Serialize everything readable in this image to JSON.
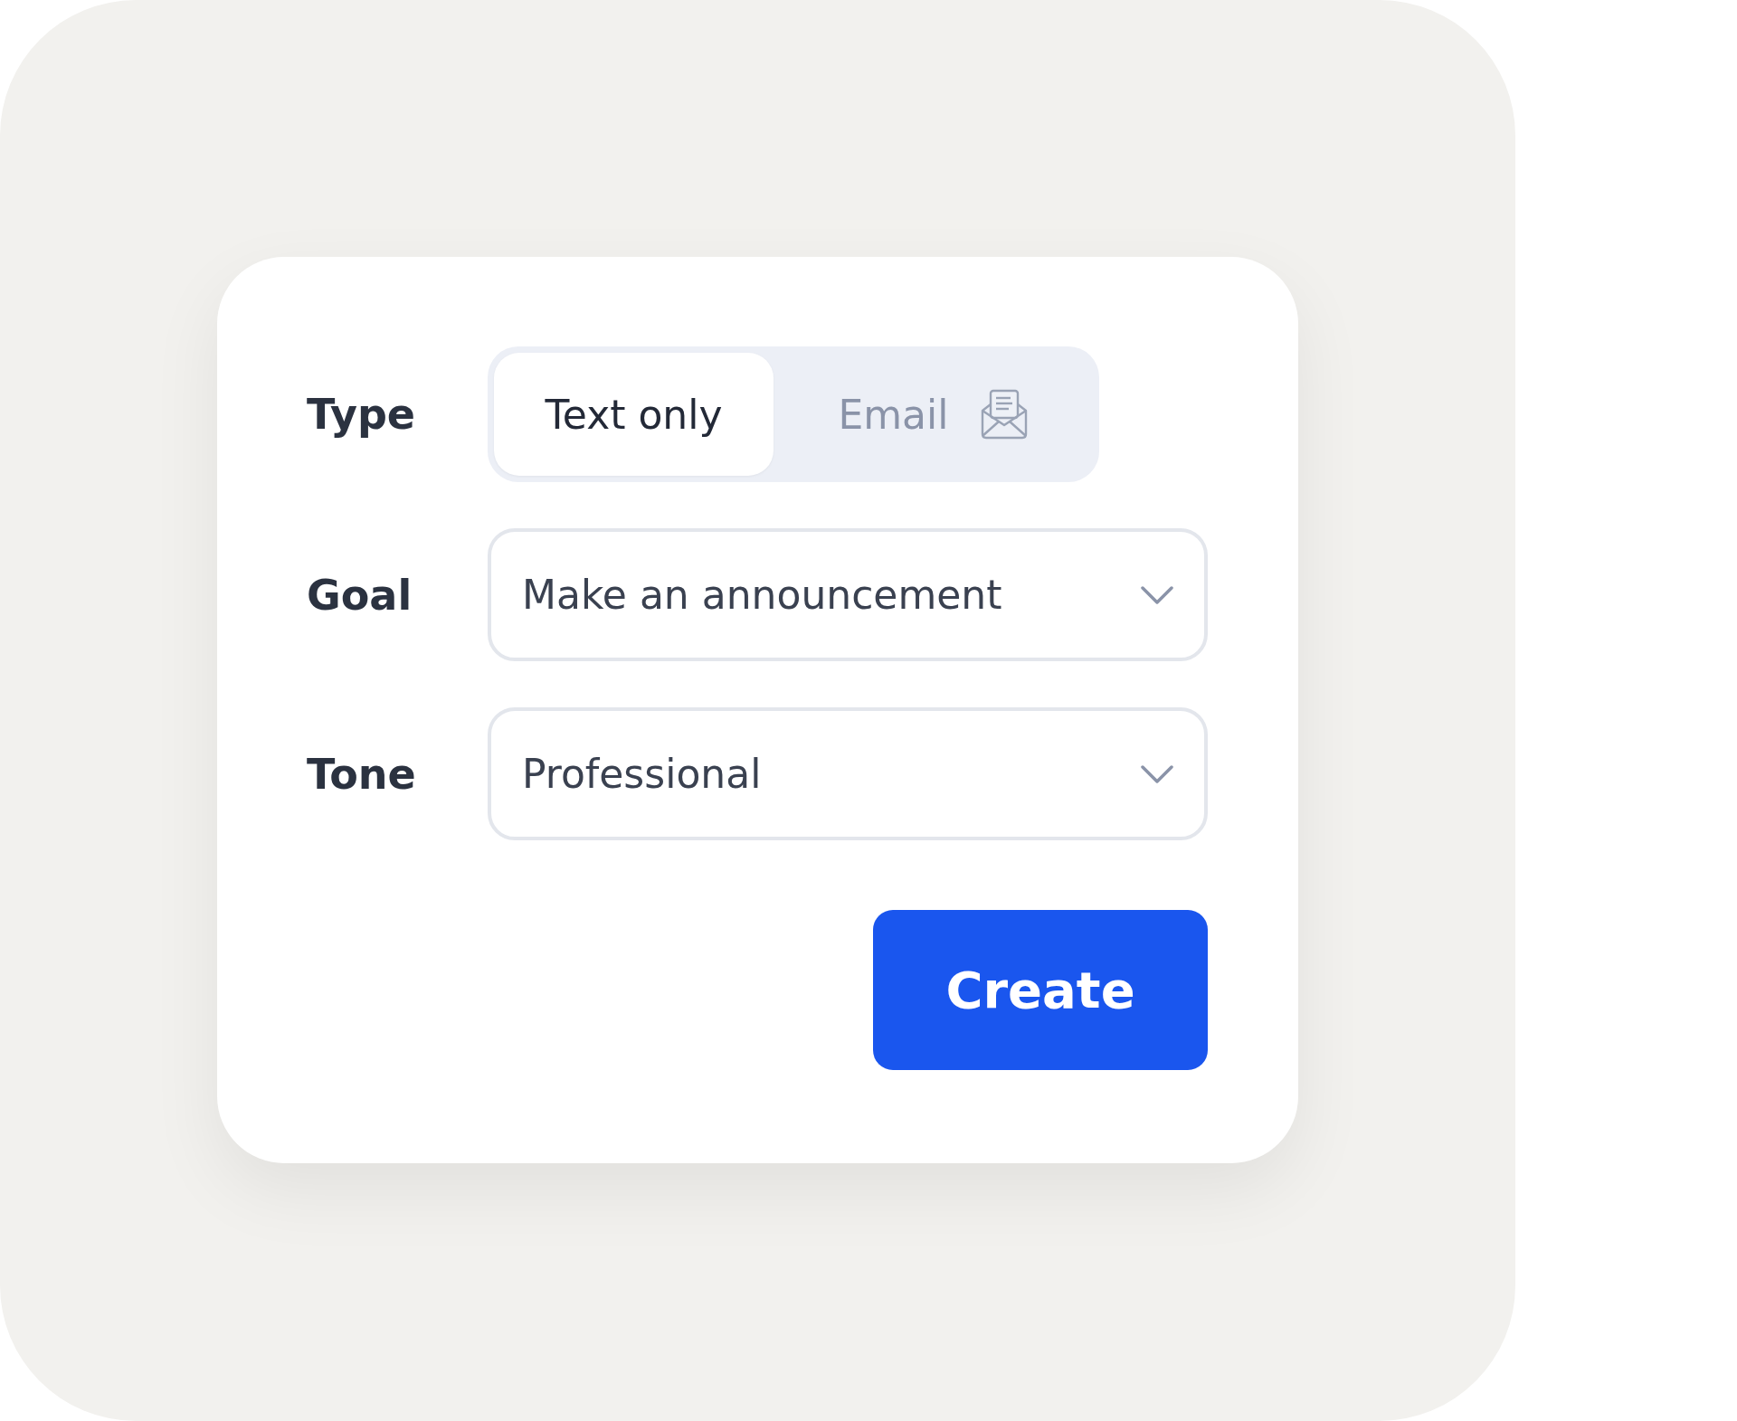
{
  "form": {
    "type": {
      "label": "Type",
      "options": [
        {
          "label": "Text only",
          "selected": true,
          "kind": "plain"
        },
        {
          "label": "Email",
          "selected": false,
          "kind": "with_icon"
        }
      ]
    },
    "goal": {
      "label": "Goal",
      "value": "Make an announcement"
    },
    "tone": {
      "label": "Tone",
      "value": "Professional"
    },
    "button": "Create"
  }
}
